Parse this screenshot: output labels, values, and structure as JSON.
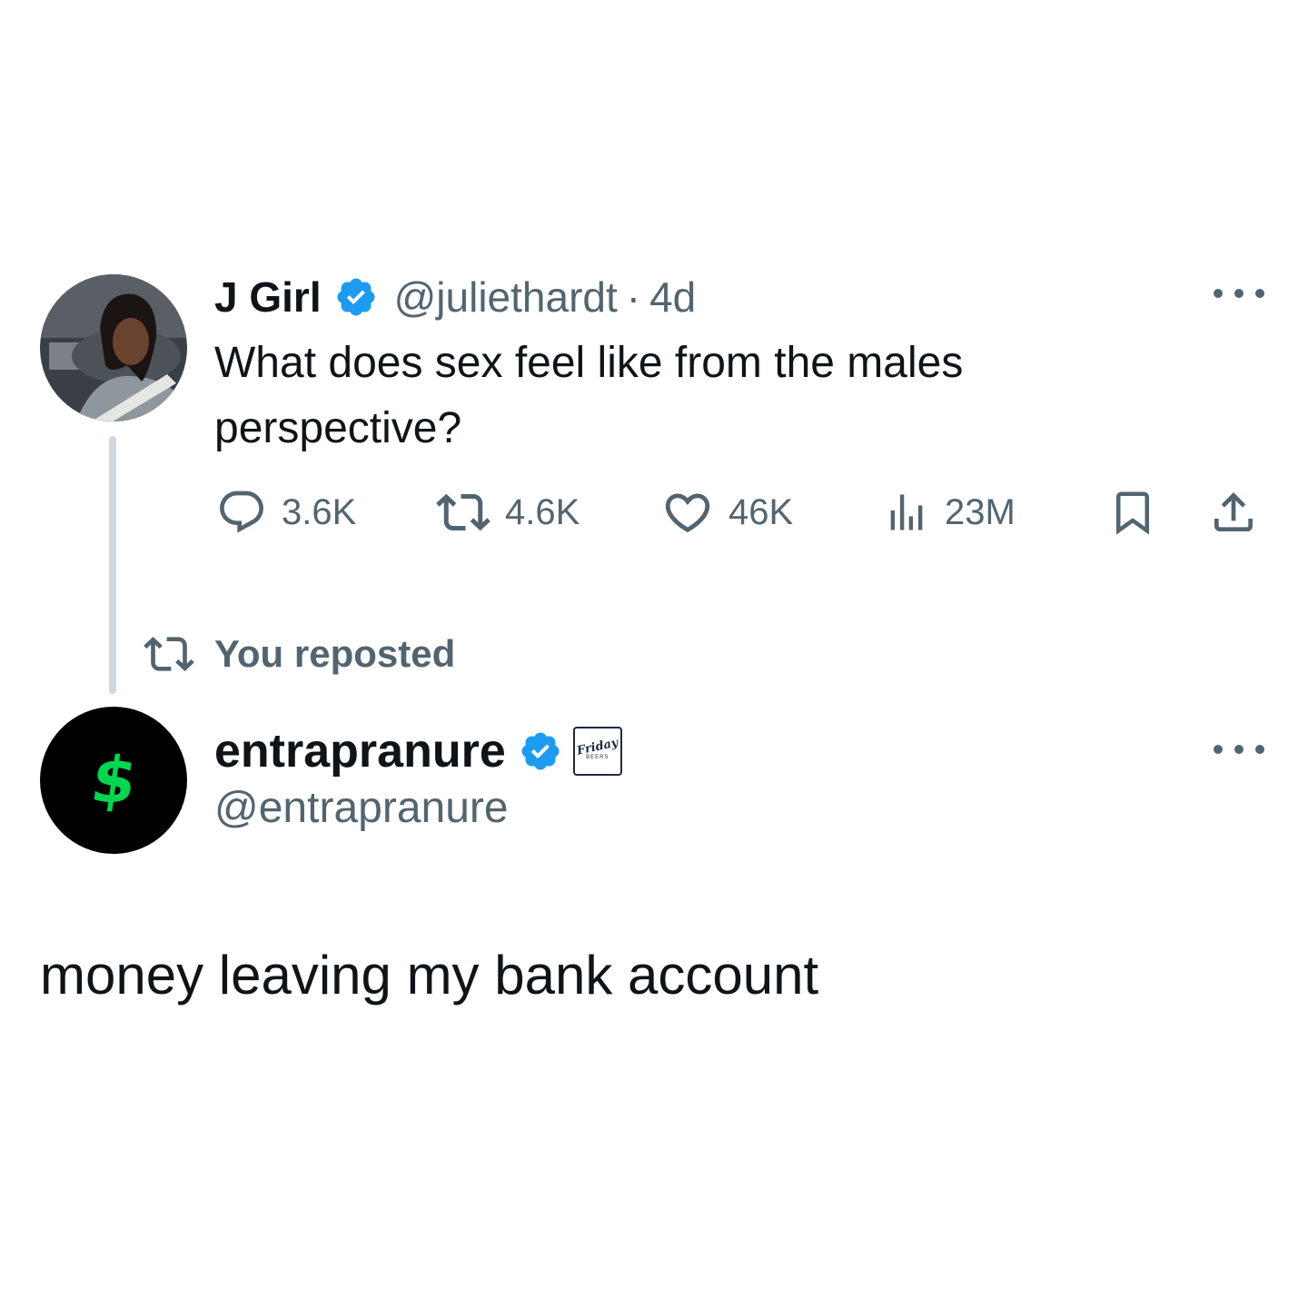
{
  "original_tweet": {
    "display_name": "J Girl",
    "handle": "@juliethardt",
    "separator": "·",
    "time": "4d",
    "verified": true,
    "avatar": "profile-photo",
    "text": "What does sex feel like from the males perspective?",
    "metrics": {
      "replies": "3.6K",
      "reposts": "4.6K",
      "likes": "46K",
      "views": "23M"
    },
    "icons": [
      "reply-icon",
      "repost-icon",
      "like-icon",
      "views-icon",
      "bookmark-icon",
      "share-icon",
      "more-icon"
    ]
  },
  "repost_banner": {
    "label": "You reposted",
    "icon": "repost-icon"
  },
  "reply_tweet": {
    "display_name": "entrapranure",
    "handle": "@entrapranure",
    "verified": true,
    "affiliate_badge": {
      "word": "Friday",
      "sub": "BEERS"
    },
    "avatar_symbol": "$",
    "text": "money leaving my bank account"
  },
  "colors": {
    "text_primary": "#0f1419",
    "text_secondary": "#536471",
    "verified_blue": "#1d9bf0",
    "thread_line": "#cfd9de",
    "cash_green": "#00d64f"
  }
}
